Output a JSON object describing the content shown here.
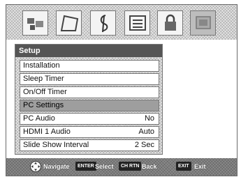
{
  "menu": {
    "title": "Setup",
    "items": [
      {
        "label": "Installation",
        "value": ""
      },
      {
        "label": "Sleep Timer",
        "value": ""
      },
      {
        "label": "On/Off Timer",
        "value": ""
      },
      {
        "label": "PC Settings",
        "value": "",
        "selected": true
      },
      {
        "label": "PC Audio",
        "value": "No"
      },
      {
        "label": "HDMI 1 Audio",
        "value": "Auto"
      },
      {
        "label": "Slide Show Interval",
        "value": "2 Sec"
      }
    ]
  },
  "tabs": [
    {
      "icon": "picture-icon"
    },
    {
      "icon": "audio-icon"
    },
    {
      "icon": "music-icon"
    },
    {
      "icon": "preferences-icon"
    },
    {
      "icon": "lock-icon"
    },
    {
      "icon": "setup-icon",
      "active": true
    }
  ],
  "footer": {
    "navigate_label": "Navigate",
    "enter_key": "ENTER",
    "select_label": "Select",
    "ch_rtn_key": "CH RTN",
    "back_label": "Back",
    "exit_key": "EXIT",
    "exit_label": "Exit"
  }
}
